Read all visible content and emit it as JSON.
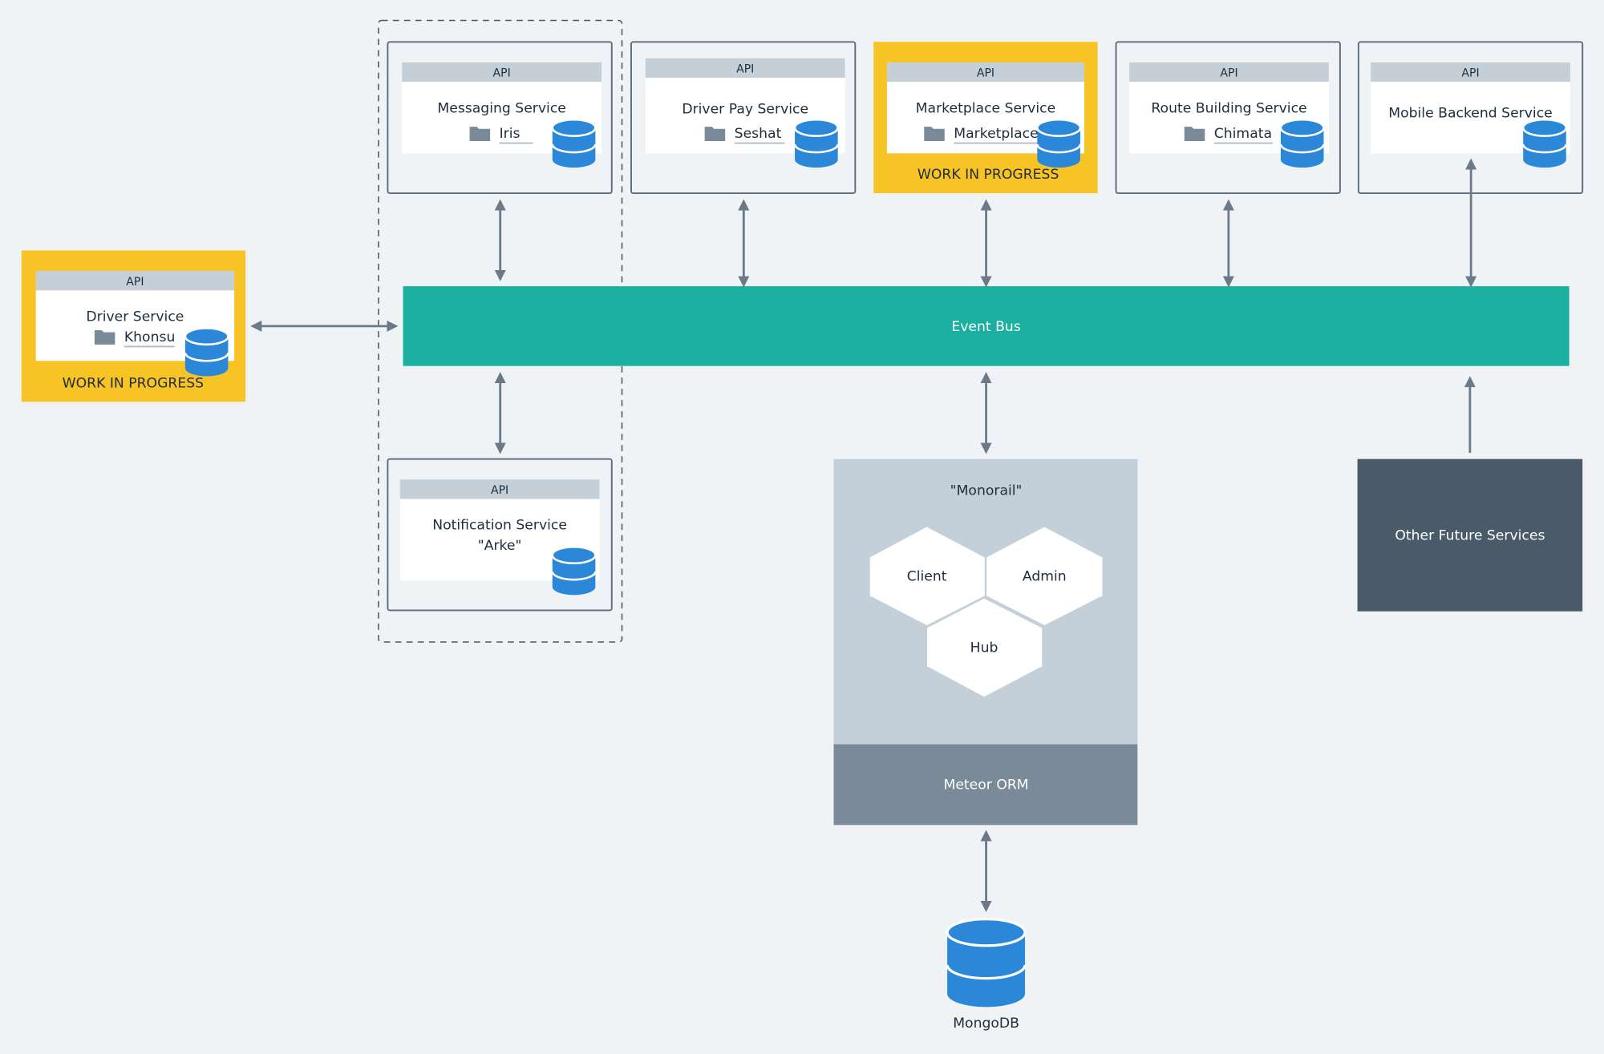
{
  "colors": {
    "background": "#eff3f6",
    "border": "#5d6b78",
    "api_header": "#c4cfd8",
    "database": "#2b88d8",
    "work_in_progress": "#f8c325",
    "event_bus": "#1aaf9e",
    "monorail": "#c4d0d9",
    "orm": "#7a8a99",
    "future_services": "#4a5a69",
    "arrow": "#6b7a88"
  },
  "services": [
    {
      "id": "driver",
      "api": "API",
      "title": "Driver Service",
      "repo": "Khonsu",
      "status": "WORK IN PROGRESS",
      "icon": "database-icon"
    },
    {
      "id": "messaging",
      "api": "API",
      "title": "Messaging Service",
      "repo": "Iris",
      "icon": "database-icon"
    },
    {
      "id": "driver-pay",
      "api": "API",
      "title": "Driver Pay Service",
      "repo": "Seshat",
      "icon": "database-icon"
    },
    {
      "id": "marketplace",
      "api": "API",
      "title": "Marketplace Service",
      "repo": "Marketplace",
      "status": "WORK IN PROGRESS",
      "icon": "database-icon"
    },
    {
      "id": "route-building",
      "api": "API",
      "title": "Route Building Service",
      "repo": "Chimata",
      "icon": "database-icon"
    },
    {
      "id": "mobile-backend",
      "api": "API",
      "title": "Mobile Backend Service",
      "icon": "database-icon"
    },
    {
      "id": "notification",
      "api": "API",
      "title": "Notification Service",
      "subtitle": "\"Arke\"",
      "icon": "database-icon"
    }
  ],
  "event_bus": {
    "label": "Event Bus"
  },
  "monorail": {
    "title": "\"Monorail\"",
    "modules": [
      "Client",
      "Admin",
      "Hub"
    ],
    "orm": "Meteor ORM"
  },
  "database": {
    "label": "MongoDB"
  },
  "future": {
    "label": "Other Future Services"
  }
}
